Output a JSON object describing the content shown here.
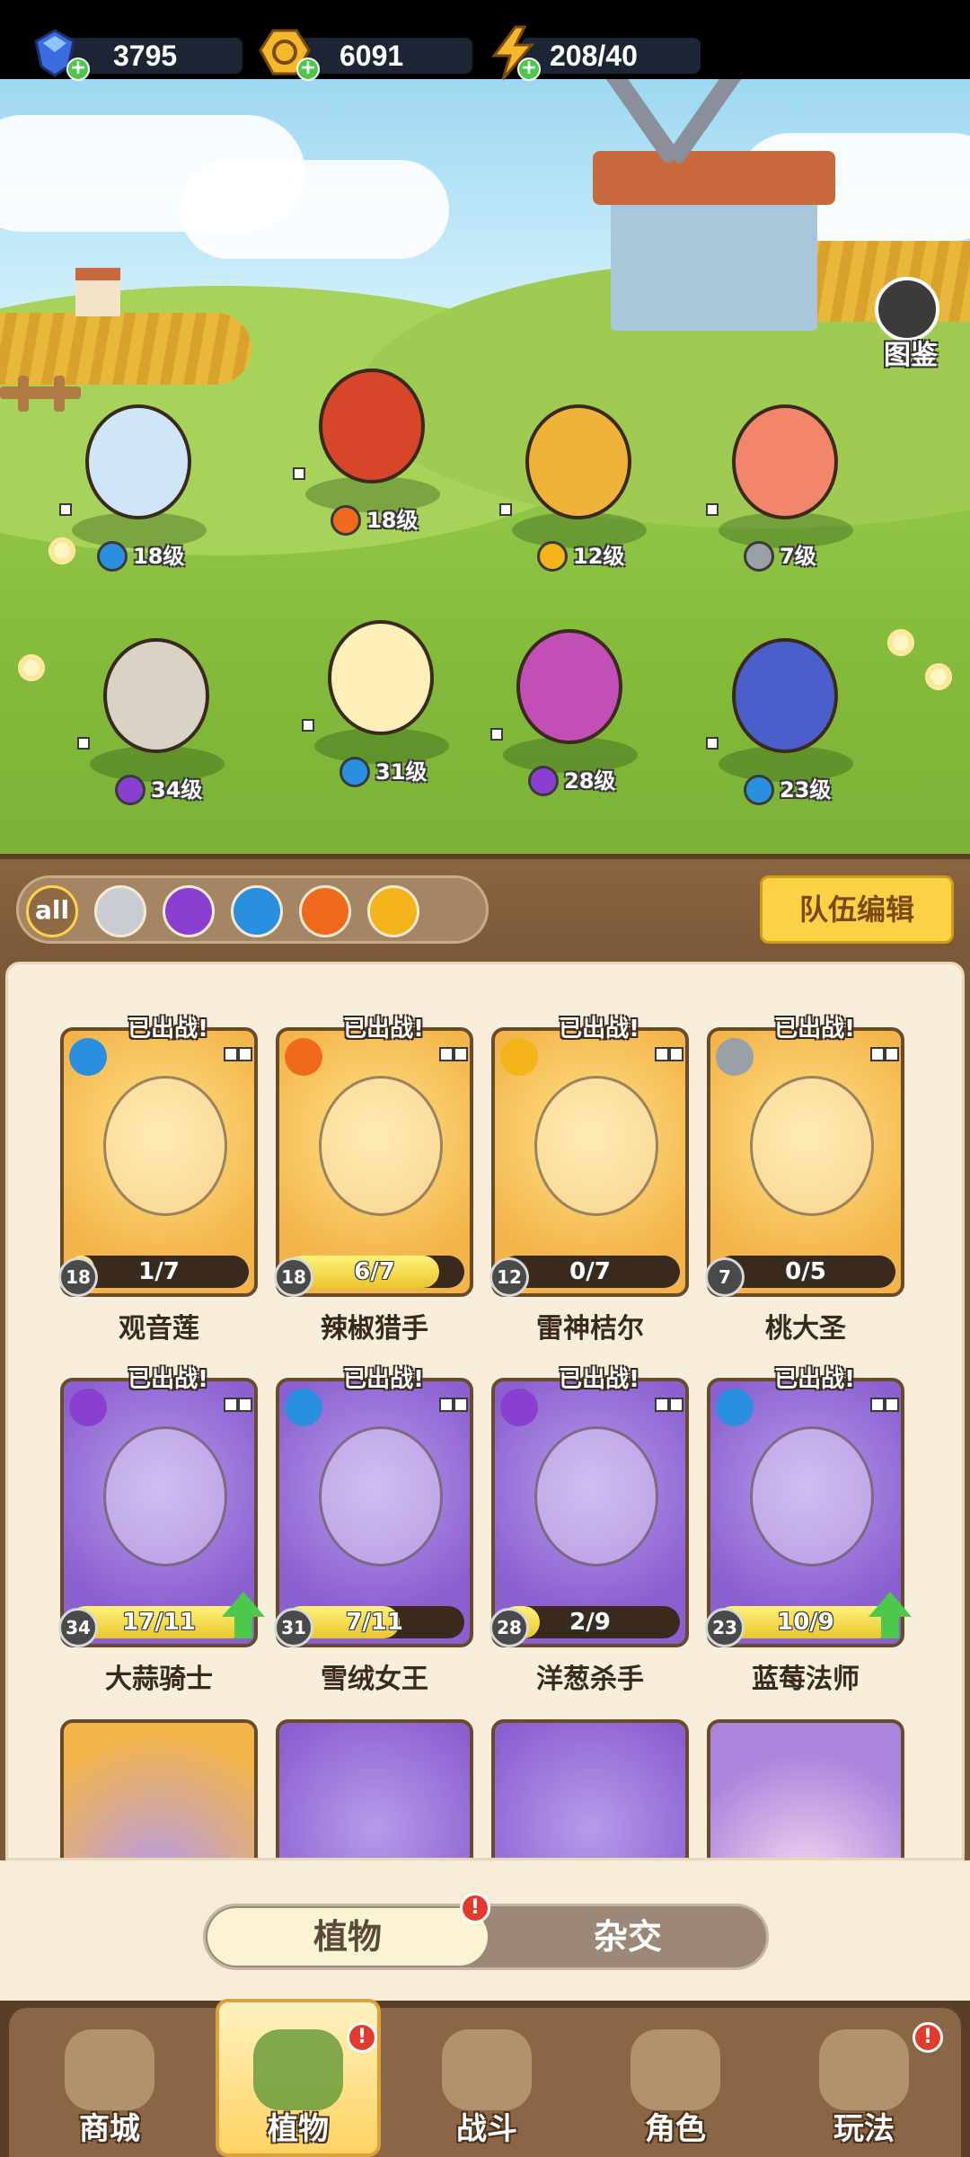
{
  "currency": {
    "gems": "3795",
    "coins": "6091",
    "energy": "208/40"
  },
  "atlas_label": "图鉴",
  "field_levels": [
    "18级",
    "18级",
    "12级",
    "7级",
    "34级",
    "31级",
    "28级",
    "23级"
  ],
  "filter": {
    "all_label": "all",
    "team_edit": "队伍编辑"
  },
  "deployed_label": "已出战!",
  "cards": [
    {
      "name": "观音莲",
      "level": "18",
      "progress": "1/7",
      "fill": 0.14,
      "color": "gold",
      "element": "water"
    },
    {
      "name": "辣椒猎手",
      "level": "18",
      "progress": "6/7",
      "fill": 0.86,
      "color": "gold",
      "element": "fire"
    },
    {
      "name": "雷神桔尔",
      "level": "12",
      "progress": "0/7",
      "fill": 0.0,
      "color": "gold",
      "element": "lightning"
    },
    {
      "name": "桃大圣",
      "level": "7",
      "progress": "0/5",
      "fill": 0.0,
      "color": "gold",
      "element": "sword"
    },
    {
      "name": "大蒜骑士",
      "level": "34",
      "progress": "17/11",
      "fill": 1.0,
      "color": "purple",
      "element": "poison"
    },
    {
      "name": "雪绒女王",
      "level": "31",
      "progress": "7/11",
      "fill": 0.64,
      "color": "purple",
      "element": "water"
    },
    {
      "name": "洋葱杀手",
      "level": "28",
      "progress": "2/9",
      "fill": 0.22,
      "color": "purple",
      "element": "poison"
    },
    {
      "name": "蓝莓法师",
      "level": "23",
      "progress": "10/9",
      "fill": 1.0,
      "color": "purple",
      "element": "water"
    }
  ],
  "toggle": {
    "plants": "植物",
    "hybrid": "杂交"
  },
  "nav": [
    "商城",
    "植物",
    "战斗",
    "角色",
    "玩法"
  ],
  "colors": {
    "water": "#2b8fe0",
    "fire": "#f06a1e",
    "lightning": "#f4b41a",
    "sword": "#9aa0a8",
    "poison": "#8a3fd1"
  }
}
